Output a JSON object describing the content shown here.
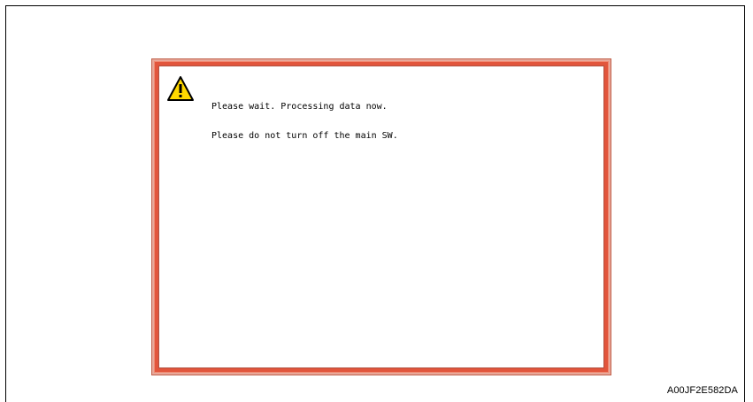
{
  "dialog": {
    "icon": "warning-icon",
    "message_lines": [
      "Please wait. Processing data now.",
      "Please do not turn off the main SW."
    ]
  },
  "figure_code": "A00JF2E582DA",
  "colors": {
    "panel_frame": "#e2553c",
    "panel_frame_light": "#e8a89a",
    "warning_fill": "#ffd800",
    "background": "#ffffff"
  }
}
